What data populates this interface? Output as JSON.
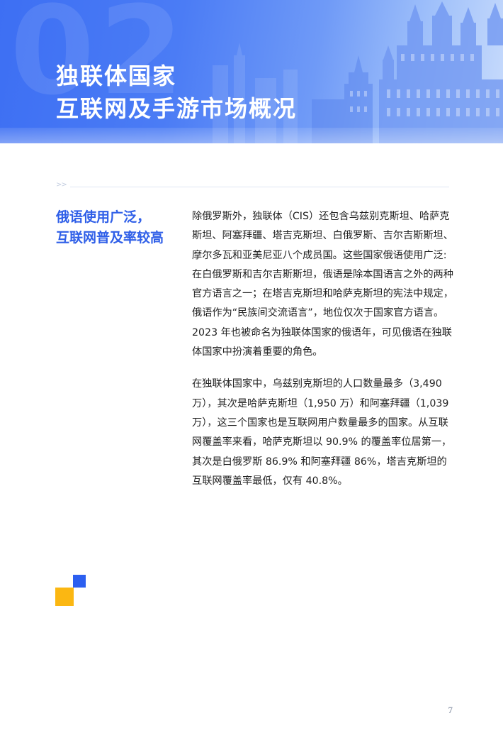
{
  "banner": {
    "section_number": "02",
    "title_line1": "独联体国家",
    "title_line2": "互联网及手游市场概况"
  },
  "divider": {
    "arrows": ">>"
  },
  "section": {
    "heading_line1": "俄语使用广泛，",
    "heading_line2": "互联网普及率较高"
  },
  "body": {
    "paragraph1": "除俄罗斯外，独联体（CIS）还包含乌兹别克斯坦、哈萨克斯坦、阿塞拜疆、塔吉克斯坦、白俄罗斯、吉尔吉斯斯坦、摩尔多瓦和亚美尼亚八个成员国。这些国家俄语使用广泛: 在白俄罗斯和吉尔吉斯斯坦，俄语是除本国语言之外的两种官方语言之一；在塔吉克斯坦和哈萨克斯坦的宪法中规定，俄语作为“民族间交流语言”，地位仅次于国家官方语言。2023 年也被命名为独联体国家的俄语年，可见俄语在独联体国家中扮演着重要的角色。",
    "paragraph2": "在独联体国家中，乌兹别克斯坦的人口数量最多（3,490 万），其次是哈萨克斯坦（1,950 万）和阿塞拜疆（1,039 万），这三个国家也是互联网用户数量最多的国家。从互联网覆盖率来看，哈萨克斯坦以 90.9% 的覆盖率位居第一，其次是白俄罗斯 86.9% 和阿塞拜疆 86%，塔吉克斯坦的互联网覆盖率最低，仅有 40.8%。"
  },
  "page_number": "7",
  "colors": {
    "accent_blue": "#2f5fe8",
    "accent_yellow": "#fbb712",
    "banner_start": "#3d6ff3",
    "banner_end": "#c9dcfc"
  }
}
